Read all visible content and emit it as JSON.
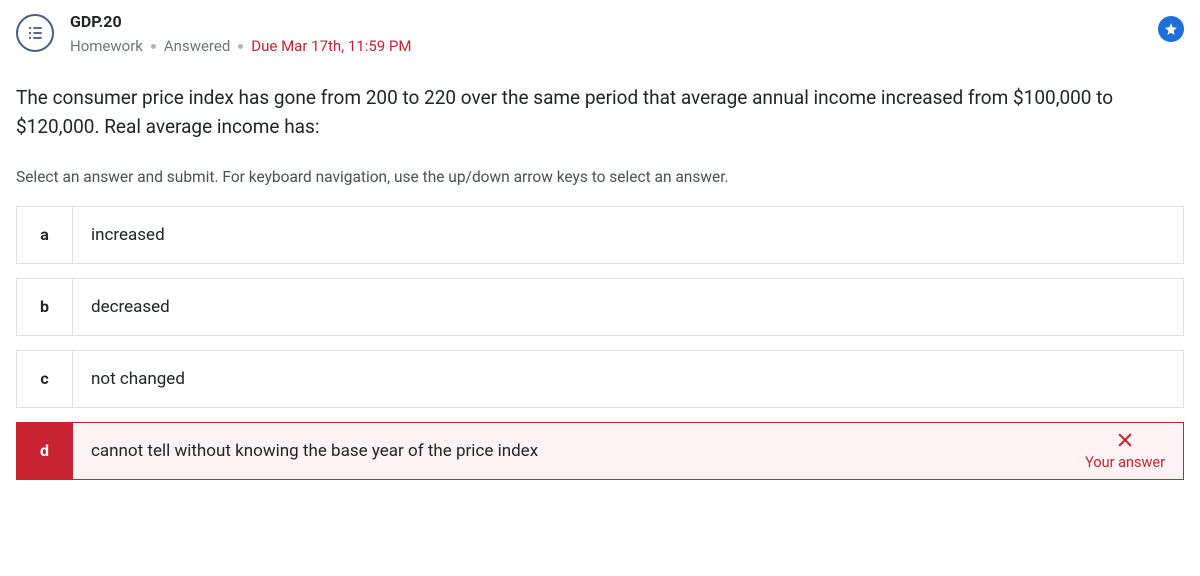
{
  "header": {
    "title": "GDP.20",
    "assignment_type": "Homework",
    "status": "Answered",
    "due": "Due Mar 17th, 11:59 PM"
  },
  "question": "The consumer price index has gone from 200 to 220 over the same period that average annual income increased from $100,000 to $120,000. Real average income has:",
  "instruction": "Select an answer and submit. For keyboard navigation, use the up/down arrow keys to select an answer.",
  "options": {
    "a": {
      "letter": "a",
      "text": "increased"
    },
    "b": {
      "letter": "b",
      "text": "decreased"
    },
    "c": {
      "letter": "c",
      "text": "not changed"
    },
    "d": {
      "letter": "d",
      "text": "cannot tell without knowing the base year of the price index"
    }
  },
  "feedback": {
    "your_answer_label": "Your answer"
  }
}
